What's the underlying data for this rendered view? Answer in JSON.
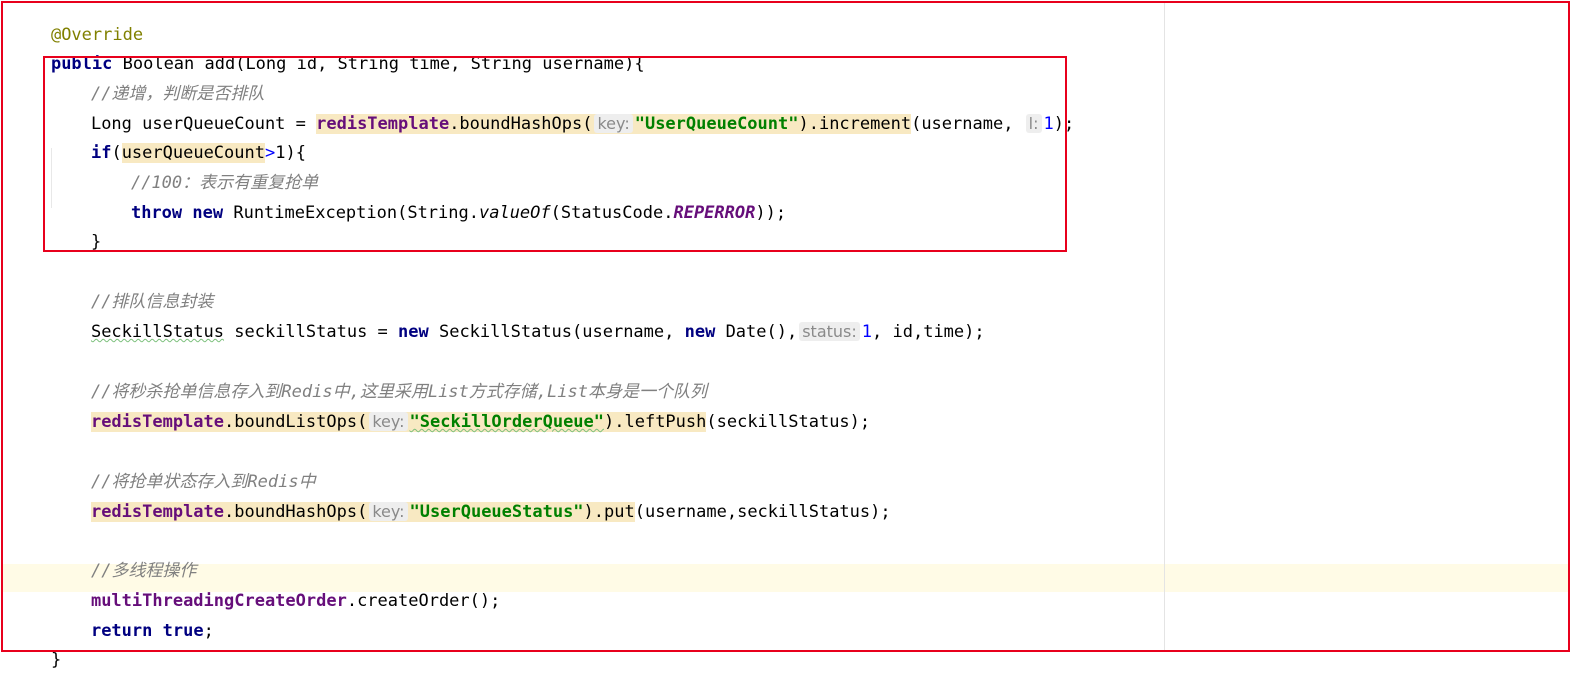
{
  "code": {
    "annotation": "@Override",
    "signature": {
      "public_kw": "public",
      "rest": "Boolean add(Long id, String time, String username){"
    },
    "comment_increment": "//递增，判断是否排队",
    "increment_line": {
      "lead": "Long userQueueCount = ",
      "template": "redisTemplate",
      "method": ".boundHashOps(",
      "hint_key": "key:",
      "key_str": "\"UserQueueCount\"",
      "call_end": ").increment",
      "args": "(username, ",
      "hint_l": "l:",
      "num": "1",
      "end": ");"
    },
    "if_line": {
      "kw": "if",
      "open": "(",
      "var": "userQueueCount",
      "gt": ">",
      "num": "1",
      "close": "){"
    },
    "comment_100": "//100：表示有重复抢单",
    "throw_line": {
      "throw_kw": "throw",
      "new_kw": "new",
      "text": " RuntimeException(String.",
      "method": "valueOf",
      "mid": "(StatusCode.",
      "const": "REPERROR",
      "end": "));"
    },
    "close_brace_if": "}",
    "comment_status": "//排队信息封装",
    "status_line": {
      "type": "SeckillStatus",
      "decl": " seckillStatus = ",
      "new_kw": "new",
      "ctor": " SeckillStatus(username, ",
      "new_kw2": "new",
      "date": " Date(),",
      "hint_status": "status:",
      "num": "1",
      "end": ", id,time);"
    },
    "comment_list": "//将秒杀抢单信息存入到Redis中,这里采用List方式存储,List本身是一个队列",
    "list_line": {
      "template": "redisTemplate",
      "method": ".boundListOps(",
      "hint_key": "key:",
      "key_str": "\"SeckillOrderQueue\"",
      "call_end": ").leftPush",
      "end": "(seckillStatus);"
    },
    "comment_hash": "//将抢单状态存入到Redis中",
    "hash_line": {
      "template": "redisTemplate",
      "method": ".boundHashOps(",
      "hint_key": "key:",
      "key_str": "\"UserQueueStatus\"",
      "call_end": ").put",
      "end": "(username,seckillStatus);"
    },
    "comment_multi": "//多线程操作",
    "multi_line": {
      "field": "multiThreadingCreateOrder",
      "end": ".createOrder();"
    },
    "return_line": {
      "kw": "return",
      "val": "true",
      "end": ";"
    },
    "close_brace": "}"
  },
  "colors": {
    "highlight_box": "#e8001c",
    "keyword": "#000080",
    "comment": "#808080",
    "string": "#008000",
    "field": "#660e7a",
    "number": "#0000ff",
    "annotation": "#808000",
    "usage_highlight": "#f8e9c2",
    "caret_row": "#fffbe6"
  }
}
